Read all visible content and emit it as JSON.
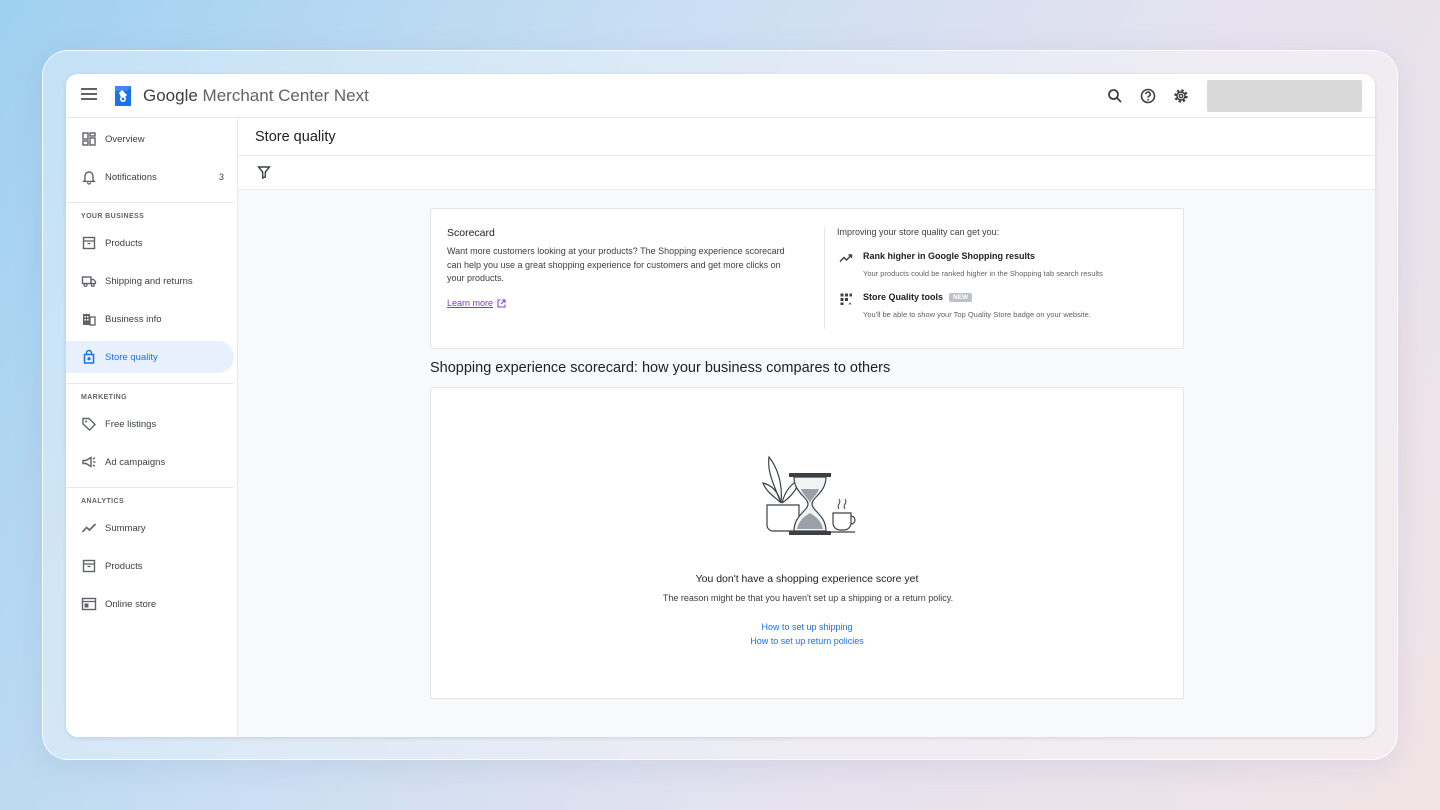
{
  "app": {
    "brand_google": "Google",
    "brand_product": " Merchant Center Next"
  },
  "sidebar": {
    "items": [
      {
        "label": "Overview"
      },
      {
        "label": "Notifications",
        "count": "3"
      }
    ],
    "sections": [
      {
        "label": "YOUR BUSINESS",
        "items": [
          {
            "label": "Products"
          },
          {
            "label": "Shipping and returns"
          },
          {
            "label": "Business info"
          },
          {
            "label": "Store quality",
            "active": true
          }
        ]
      },
      {
        "label": "MARKETING",
        "items": [
          {
            "label": "Free listings"
          },
          {
            "label": "Ad campaigns"
          }
        ]
      },
      {
        "label": "ANALYTICS",
        "items": [
          {
            "label": "Summary"
          },
          {
            "label": "Products"
          },
          {
            "label": "Online store"
          }
        ]
      }
    ]
  },
  "page": {
    "title": "Store quality"
  },
  "scorecard": {
    "title": "Scorecard",
    "description": "Want more customers looking at your products? The Shopping experience scorecard can help you use a great shopping experience for customers and get more clicks on your products.",
    "learn_more": "Learn more",
    "improving_title": "Improving your store quality can get you:",
    "benefits": [
      {
        "title": "Rank higher in Google Shopping results",
        "description": "Your products could be ranked higher in the Shopping tab search results"
      },
      {
        "title": "Store Quality tools",
        "badge": "NEW",
        "description": "You'll be able to show your Top Quality Store badge on your website."
      }
    ]
  },
  "comparison": {
    "heading": "Shopping experience scorecard: how your business compares to others",
    "empty_title": "You don't have a shopping experience score yet",
    "empty_description": "The reason might be that you haven't set up a shipping or a return policy.",
    "link_shipping": "How to set up shipping",
    "link_returns": "How to set up return policies"
  },
  "colors": {
    "accent": "#1a73e8",
    "active_bg": "#e8f0fe",
    "learn_more": "#7b3fbf"
  }
}
